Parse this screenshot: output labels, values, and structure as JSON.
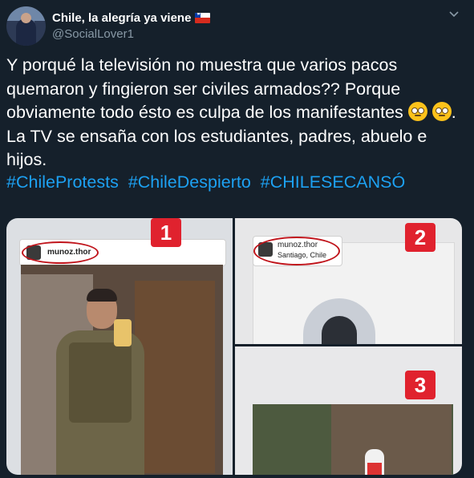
{
  "tweet": {
    "display_name": "Chile, la alegría ya viene",
    "handle": "@SocialLover1",
    "body_parts": {
      "part1": "Y porqué la televisión no muestra que varios pacos quemaron y fingieron ser civiles armados?? Porque obviamente todo ésto es culpa de los manifestantes ",
      "part2": ". La TV se ensaña con los estudiantes, padres, abuelo e hijos."
    },
    "hashtags": [
      "#ChileProtests",
      "#ChileDespierto",
      "#CHILESECANSÓ"
    ]
  },
  "icons": {
    "flag": "chile-flag-icon",
    "emoji": "face-with-rolling-eyes-icon",
    "menu": "chevron-down-icon"
  },
  "media": {
    "photos": [
      {
        "badge": "1",
        "ig_user": "munoz.thor",
        "ig_location": ""
      },
      {
        "badge": "2",
        "ig_user": "munoz.thor",
        "ig_location": "Santiago, Chile"
      },
      {
        "badge": "3",
        "ig_user": "",
        "ig_location": ""
      }
    ]
  },
  "colors": {
    "background": "#15202b",
    "text": "#ffffff",
    "secondary": "#8899a6",
    "link": "#1da1f2",
    "badge": "#e0222e"
  }
}
